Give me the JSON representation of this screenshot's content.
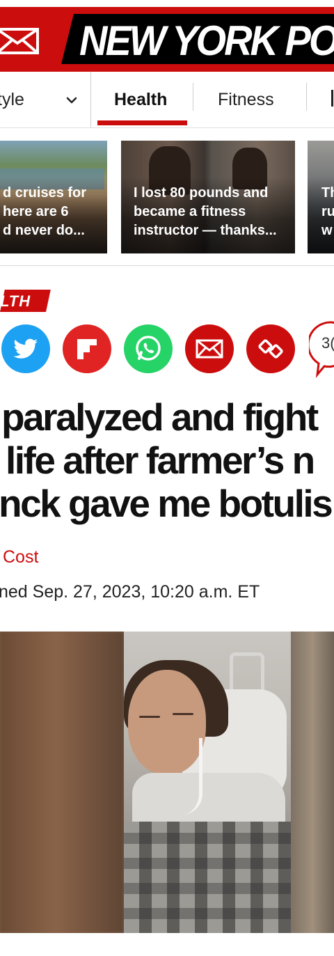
{
  "header": {
    "logo_text": "NEW YORK POST",
    "mail_icon": "mail-icon",
    "brand_color": "#cc0d0d"
  },
  "nav": {
    "items": [
      {
        "label": "tyle",
        "has_dropdown": true
      },
      {
        "label": "Health",
        "active": true
      },
      {
        "label": "Fitness"
      }
    ],
    "dropdown_icon": "chevron-down-icon"
  },
  "related_cards": [
    {
      "title": "d cruises for\n here are 6\nd never do..."
    },
    {
      "title": "I lost 80 pounds and\nbecame a fitness\ninstructor — thanks..."
    },
    {
      "title": "Th\nru\nw"
    }
  ],
  "article": {
    "section_label": "LTH",
    "share_icons": [
      "twitter-icon",
      "flipboard-icon",
      "whatsapp-icon",
      "email-icon",
      "link-icon",
      "comment-icon"
    ],
    "comment_count": "3(",
    "headline_lines": [
      "paralyzed and fight",
      "life after farmer’s n",
      "nck gave me botulis"
    ],
    "byline": "Cost",
    "published": "ned Sep. 27, 2023, 10:20 a.m. ET"
  },
  "colors": {
    "twitter": "#1da1f2",
    "flipboard": "#e02424",
    "whatsapp": "#25d366",
    "red": "#cc0d0d"
  }
}
